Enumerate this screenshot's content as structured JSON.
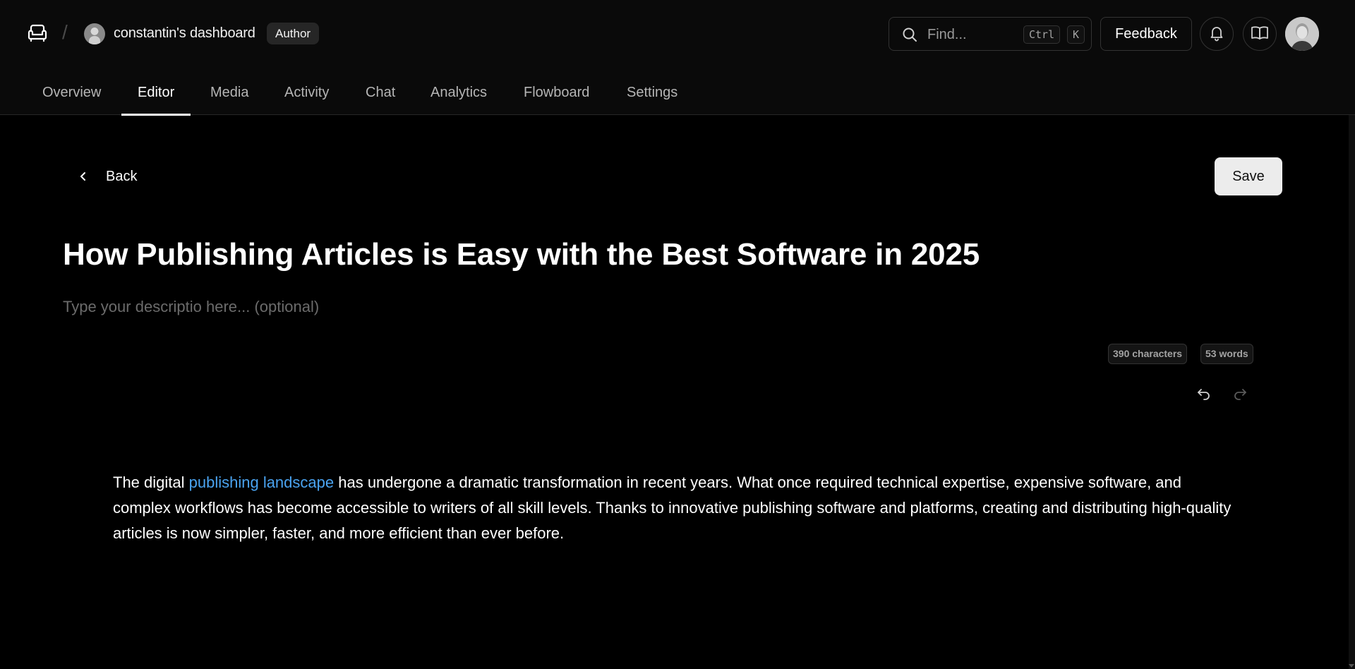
{
  "header": {
    "dashboard_name": "constantin's dashboard",
    "role_badge": "Author",
    "search": {
      "placeholder": "Find...",
      "shortcut_ctrl": "Ctrl",
      "shortcut_key": "K"
    },
    "feedback_label": "Feedback",
    "icons": [
      "logo-icon",
      "search-icon",
      "bell-icon",
      "book-open-icon"
    ]
  },
  "tabs": [
    {
      "label": "Overview",
      "active": false
    },
    {
      "label": "Editor",
      "active": true
    },
    {
      "label": "Media",
      "active": false
    },
    {
      "label": "Activity",
      "active": false
    },
    {
      "label": "Chat",
      "active": false
    },
    {
      "label": "Analytics",
      "active": false
    },
    {
      "label": "Flowboard",
      "active": false
    },
    {
      "label": "Settings",
      "active": false
    }
  ],
  "editor": {
    "back_label": "Back",
    "save_label": "Save",
    "title": "How Publishing Articles is Easy with the Best Software in 2025",
    "description_placeholder": "Type your descriptio here... (optional)",
    "description_value": "",
    "stats": {
      "characters": "390 characters",
      "words": "53 words"
    },
    "content": {
      "before_link": "The digital ",
      "link_text": "publishing landscape",
      "after_link": " has undergone a dramatic transformation in recent years. What once required technical expertise, expensive software, and complex workflows has become accessible to writers of all skill levels. Thanks to innovative publishing software and platforms, creating and distributing high-quality articles is now simpler, faster, and more efficient than ever before."
    }
  },
  "colors": {
    "background": "#000000",
    "header_background": "#0a0a0a",
    "link": "#4aa3f0",
    "save_button": "#ececec",
    "muted_text": "#6b6b6b"
  }
}
